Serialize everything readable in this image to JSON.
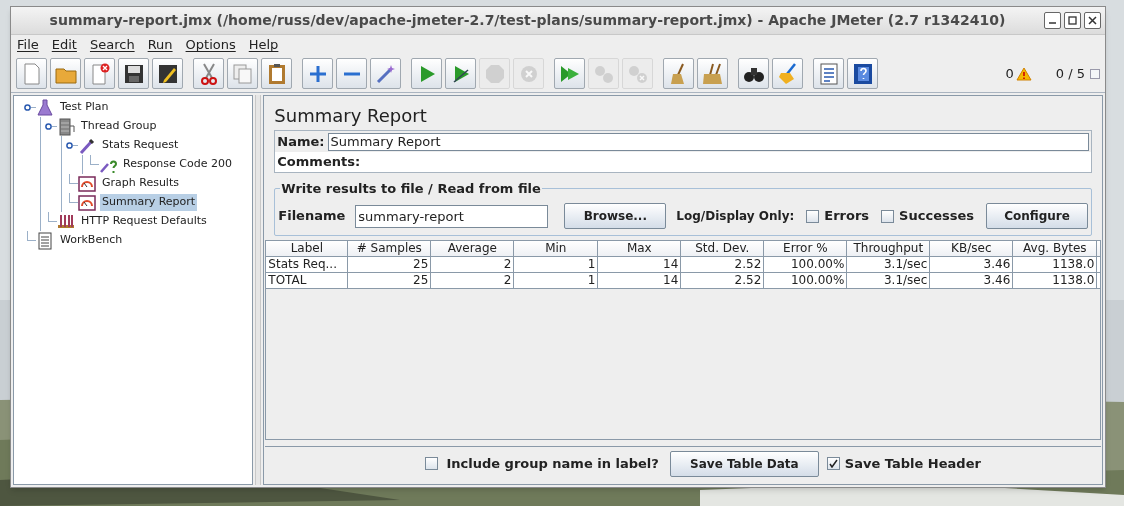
{
  "window": {
    "title": "summary-report.jmx (/home/russ/dev/apache-jmeter-2.7/test-plans/summary-report.jmx) - Apache JMeter (2.7 r1342410)"
  },
  "menu": [
    "File",
    "Edit",
    "Search",
    "Run",
    "Options",
    "Help"
  ],
  "toolbar": [
    [
      {
        "kind": "new",
        "disabled": false
      },
      {
        "kind": "open",
        "disabled": false
      },
      {
        "kind": "close",
        "disabled": false
      },
      {
        "kind": "save",
        "disabled": false
      },
      {
        "kind": "save-as",
        "disabled": false
      }
    ],
    [
      {
        "kind": "cut",
        "disabled": false
      },
      {
        "kind": "copy",
        "disabled": false
      },
      {
        "kind": "paste",
        "disabled": false
      }
    ],
    [
      {
        "kind": "add",
        "disabled": false
      },
      {
        "kind": "remove",
        "disabled": false
      },
      {
        "kind": "toggle",
        "disabled": false
      }
    ],
    [
      {
        "kind": "start",
        "disabled": false
      },
      {
        "kind": "start-no-pause",
        "disabled": false
      },
      {
        "kind": "stop",
        "disabled": true
      },
      {
        "kind": "shutdown",
        "disabled": true
      }
    ],
    [
      {
        "kind": "remote-start",
        "disabled": false
      },
      {
        "kind": "remote-stop",
        "disabled": true
      },
      {
        "kind": "remote-shutdown",
        "disabled": true
      }
    ],
    [
      {
        "kind": "clear",
        "disabled": false
      },
      {
        "kind": "clear-all",
        "disabled": false
      }
    ],
    [
      {
        "kind": "search",
        "disabled": false
      },
      {
        "kind": "reset-search",
        "disabled": false
      }
    ],
    [
      {
        "kind": "function",
        "disabled": false
      },
      {
        "kind": "help",
        "disabled": false
      }
    ]
  ],
  "status": {
    "warnings": "0",
    "threads": "0 / 5"
  },
  "tree": [
    {
      "label": "Test Plan",
      "kind": "plan",
      "selected": false,
      "children": [
        {
          "label": "Thread Group",
          "kind": "thread",
          "selected": false,
          "children": [
            {
              "label": "Stats Request",
              "kind": "sampler",
              "selected": false,
              "children": [
                {
                  "label": "Response Code 200",
                  "kind": "assertion",
                  "selected": false
                }
              ]
            },
            {
              "label": "Graph Results",
              "kind": "listener",
              "selected": false
            },
            {
              "label": "Summary Report",
              "kind": "listener",
              "selected": true
            }
          ]
        },
        {
          "label": "HTTP Request Defaults",
          "kind": "config",
          "selected": false
        }
      ]
    },
    {
      "label": "WorkBench",
      "kind": "workbench",
      "selected": false
    }
  ],
  "panel": {
    "title": "Summary Report",
    "name_label": "Name:",
    "name_value": "Summary Report",
    "comments_label": "Comments:",
    "file_group": {
      "legend": "Write results to file / Read from file",
      "filename_label": "Filename",
      "filename_value": "summary-report",
      "browse": "Browse...",
      "log_label": "Log/Display Only:",
      "options": [
        {
          "label": "Errors",
          "checked": false
        },
        {
          "label": "Successes",
          "checked": false
        }
      ],
      "configure": "Configure"
    }
  },
  "table": {
    "columns": [
      "Label",
      "# Samples",
      "Average",
      "Min",
      "Max",
      "Std. Dev.",
      "Error %",
      "Throughput",
      "KB/sec",
      "Avg. Bytes"
    ],
    "rows": [
      [
        "Stats Req...",
        "25",
        "2",
        "1",
        "14",
        "2.52",
        "100.00%",
        "3.1/sec",
        "3.46",
        "1138.0"
      ],
      [
        "TOTAL",
        "25",
        "2",
        "1",
        "14",
        "2.52",
        "100.00%",
        "3.1/sec",
        "3.46",
        "1138.0"
      ]
    ]
  },
  "footer": {
    "include_group": {
      "label": "Include group name in label?",
      "checked": false
    },
    "save_data": "Save Table Data",
    "save_header": {
      "label": "Save Table Header",
      "checked": true
    }
  }
}
